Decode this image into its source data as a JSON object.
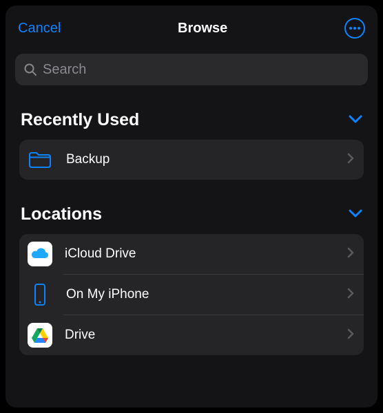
{
  "colors": {
    "accent": "#0a84ff",
    "background": "#141316",
    "surface": "#252427",
    "searchBg": "#2a292c"
  },
  "navbar": {
    "cancel_label": "Cancel",
    "title": "Browse"
  },
  "search": {
    "placeholder": "Search",
    "value": ""
  },
  "sections": {
    "recent": {
      "title": "Recently Used",
      "items": [
        {
          "label": "Backup",
          "icon": "folder-icon"
        }
      ]
    },
    "locations": {
      "title": "Locations",
      "items": [
        {
          "label": "iCloud Drive",
          "icon": "icloud-icon"
        },
        {
          "label": "On My iPhone",
          "icon": "iphone-icon"
        },
        {
          "label": "Drive",
          "icon": "google-drive-icon"
        }
      ]
    }
  }
}
